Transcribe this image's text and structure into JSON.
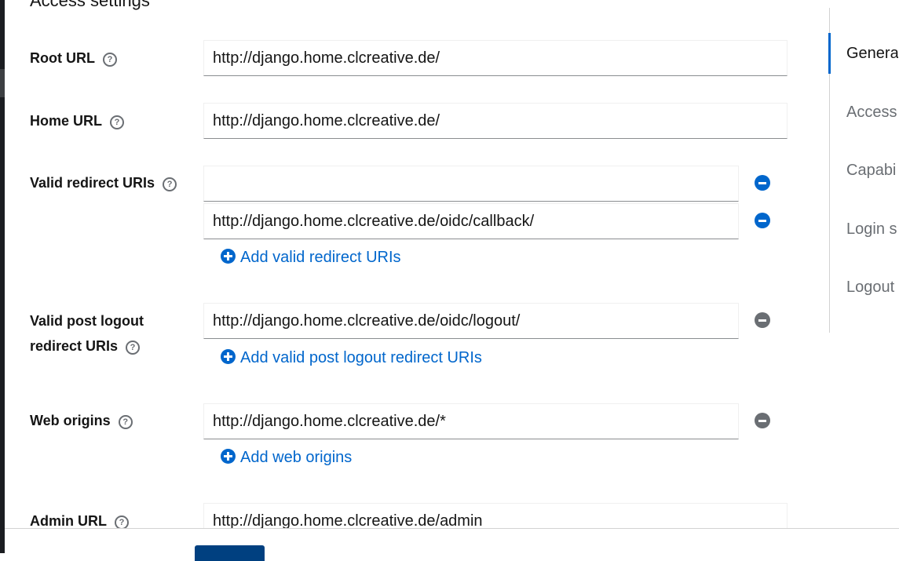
{
  "section": {
    "title": "Access settings"
  },
  "fields": {
    "root_url": {
      "label": "Root URL",
      "value": "http://django.home.clcreative.de/"
    },
    "home_url": {
      "label": "Home URL",
      "value": "http://django.home.clcreative.de/"
    },
    "redirect_uris": {
      "label": "Valid redirect URIs",
      "values": [
        "",
        "http://django.home.clcreative.de/oidc/callback/"
      ],
      "add_label": "Add valid redirect URIs"
    },
    "post_logout": {
      "label_line1": "Valid post logout",
      "label_line2": "redirect URIs",
      "values": [
        "http://django.home.clcreative.de/oidc/logout/"
      ],
      "add_label": "Add valid post logout redirect URIs"
    },
    "web_origins": {
      "label": "Web origins",
      "values": [
        "http://django.home.clcreative.de/*"
      ],
      "add_label": "Add web origins"
    },
    "admin_url": {
      "label": "Admin URL",
      "value": "http://django.home.clcreative.de/admin"
    }
  },
  "jump_links": [
    "General",
    "Access",
    "Capabi",
    "Login s",
    "Logout"
  ],
  "help_glyph": "?",
  "colors": {
    "link": "#0066cc",
    "remove_disabled": "#6a6e73",
    "save_button": "#004080"
  }
}
